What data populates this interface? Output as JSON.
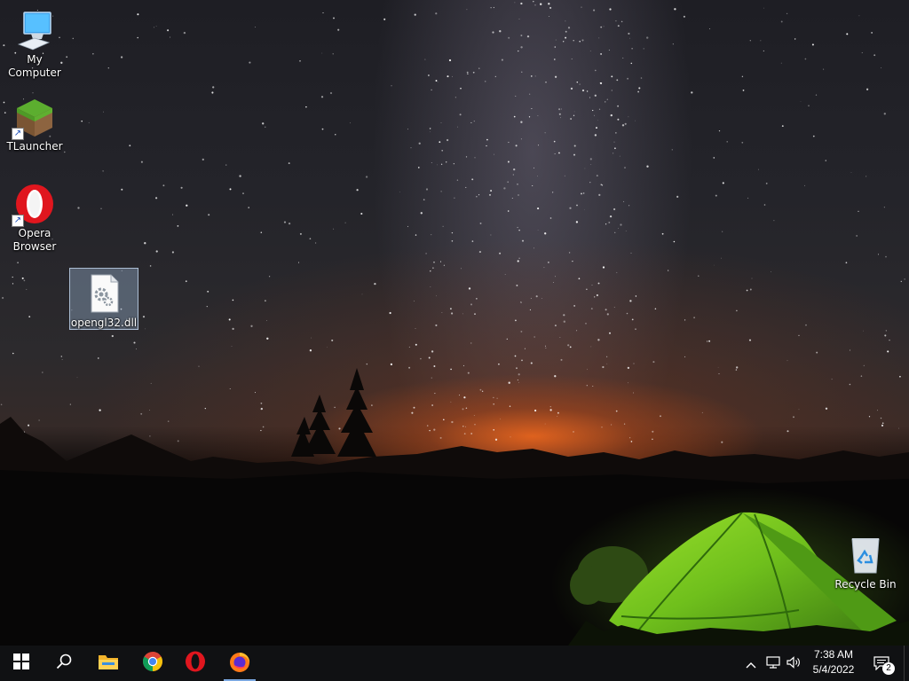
{
  "desktop": {
    "wallpaper": "night-sky-milky-way-tent",
    "icons": [
      {
        "label": "My Computer",
        "icon": "computer-icon"
      },
      {
        "label": "TLauncher",
        "icon": "minecraft-grass-block-icon"
      },
      {
        "label": "Opera Browser",
        "icon": "opera-icon"
      },
      {
        "label": "opengl32.dll",
        "icon": "dll-file-icon"
      },
      {
        "label": "Recycle Bin",
        "icon": "recycle-bin-icon"
      }
    ]
  },
  "taskbar": {
    "apps": [
      {
        "name": "Start",
        "icon": "windows-start-icon"
      },
      {
        "name": "Search",
        "icon": "search-icon"
      },
      {
        "name": "File Explorer",
        "icon": "folder-icon"
      },
      {
        "name": "Google Chrome",
        "icon": "chrome-icon"
      },
      {
        "name": "Opera",
        "icon": "opera-icon"
      },
      {
        "name": "Firefox",
        "icon": "firefox-icon"
      }
    ],
    "tray": {
      "time": "7:38 AM",
      "date": "5/4/2022",
      "notification_count": "2"
    }
  },
  "colors": {
    "taskbar_bg": "#101113",
    "selection": "#aac8eb",
    "tent_green": "#7ed321"
  }
}
